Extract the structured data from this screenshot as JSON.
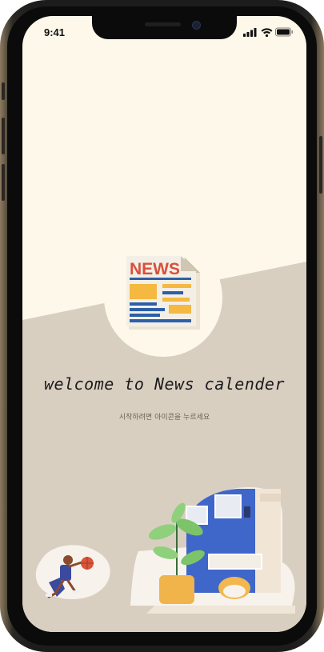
{
  "status_bar": {
    "time": "9:41",
    "signal_icon": "cellular-signal-icon",
    "wifi_icon": "wifi-icon",
    "battery_icon": "battery-icon"
  },
  "main": {
    "icon": "newspaper-icon",
    "icon_label": "NEWS",
    "welcome_text": "welcome to News calender",
    "hint_text": "시작하려면 아이콘을 누르세요"
  },
  "illustrations": {
    "left": "basketball-player-illustration",
    "right": "room-with-cat-and-plant-illustration"
  },
  "colors": {
    "screen_top": "#fdf8ea",
    "screen_bottom": "#d9cfc1",
    "news_red": "#d94f3d",
    "news_yellow": "#f5b841",
    "news_blue": "#2d5fa8",
    "room_blue": "#3f66c9"
  }
}
